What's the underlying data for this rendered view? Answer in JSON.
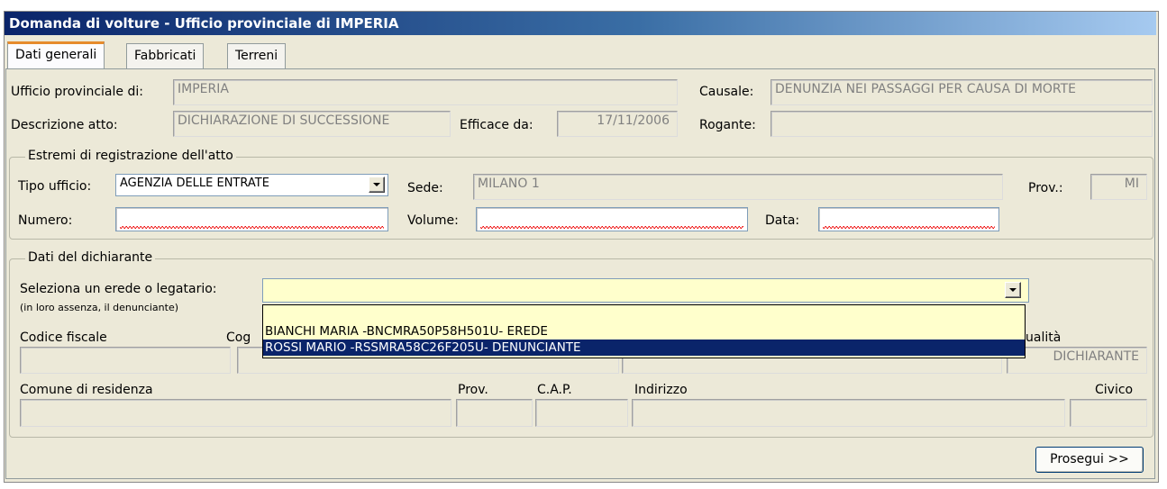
{
  "window": {
    "title": "Domanda di volture - Ufficio provinciale di IMPERIA"
  },
  "tabs": [
    {
      "label": "Dati generali",
      "active": true
    },
    {
      "label": "Fabbricati",
      "active": false
    },
    {
      "label": "Terreni",
      "active": false
    }
  ],
  "general": {
    "ufficio_label": "Ufficio provinciale di:",
    "ufficio_value": "IMPERIA",
    "causale_label": "Causale:",
    "causale_value": "DENUNZIA NEI PASSAGGI PER CAUSA DI MORTE",
    "descrizione_label": "Descrizione atto:",
    "descrizione_value": "DICHIARAZIONE DI SUCCESSIONE",
    "efficace_label": "Efficace da:",
    "efficace_value": "17/11/2006",
    "rogante_label": "Rogante:",
    "rogante_value": ""
  },
  "registrazione": {
    "legend": "Estremi di registrazione dell'atto",
    "tipo_ufficio_label": "Tipo ufficio:",
    "tipo_ufficio_value": "AGENZIA DELLE ENTRATE",
    "sede_label": "Sede:",
    "sede_value": "MILANO 1",
    "prov_label": "Prov.:",
    "prov_value": "MI",
    "numero_label": "Numero:",
    "volume_label": "Volume:",
    "data_label": "Data:"
  },
  "dichiarante": {
    "legend": "Dati del dichiarante",
    "seleziona_label": "Seleziona un erede o legatario:",
    "seleziona_hint": "(in loro assenza, il denunciante)",
    "options": [
      {
        "label": "BIANCHI MARIA -BNCMRA50P58H501U- EREDE",
        "selected": false
      },
      {
        "label": "ROSSI MARIO -RSSMRA58C26F205U- DENUNCIANTE",
        "selected": true
      }
    ],
    "codice_fiscale_label": "Codice fiscale",
    "cognome_label_partial": "Cog",
    "qualita_label_partial": "ualità",
    "qualita_value_partial": "DICHIARANTE",
    "comune_label": "Comune di residenza",
    "prov_label": "Prov.",
    "cap_label": "C.A.P.",
    "indirizzo_label": "Indirizzo",
    "civico_label": "Civico"
  },
  "actions": {
    "prosegui_label": "Prosegui >>"
  },
  "colors": {
    "titlebar_start": "#0a246a",
    "titlebar_end": "#a6caf0",
    "window_bg": "#ece9d8",
    "dropdown_bg": "#ffffcc",
    "selection_bg": "#0a246a",
    "tab_accent": "#e68b2c"
  }
}
